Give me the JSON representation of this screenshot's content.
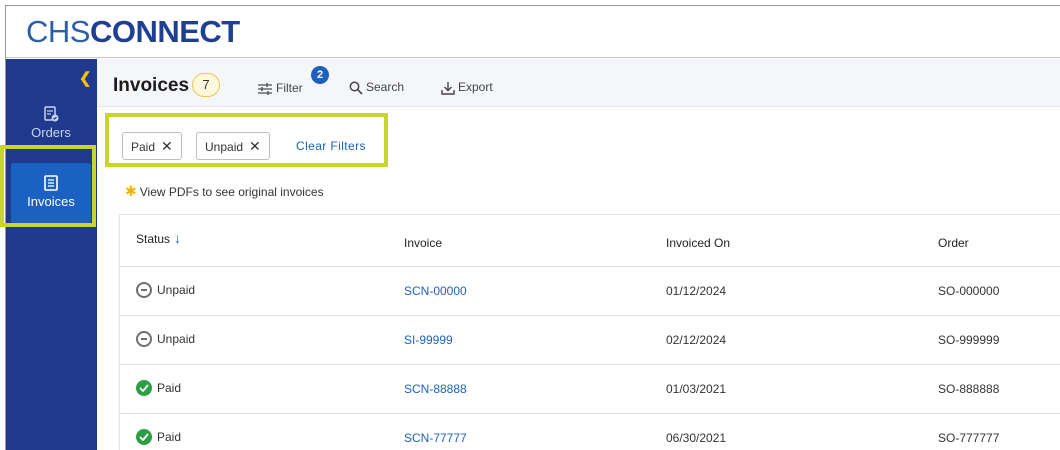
{
  "brand": {
    "part1": "CHS",
    "part2": "CONNECT"
  },
  "sidebar": {
    "collapse_icon": "chevron-left-icon",
    "items": [
      {
        "label": "Orders",
        "icon": "orders-document-icon",
        "active": false
      },
      {
        "label": "Invoices",
        "icon": "invoice-document-icon",
        "active": true
      }
    ]
  },
  "header": {
    "title": "Invoices",
    "count": "7",
    "filter_label": "Filter",
    "filter_badge": "2",
    "search_label": "Search",
    "export_label": "Export"
  },
  "filters": {
    "chips": [
      {
        "label": "Paid"
      },
      {
        "label": "Unpaid"
      }
    ],
    "clear_label": "Clear Filters"
  },
  "note": "View PDFs to see original invoices",
  "table": {
    "columns": [
      "Status",
      "Invoice",
      "Invoiced On",
      "Order"
    ],
    "rows": [
      {
        "status": "Unpaid",
        "invoice": "SCN-00000",
        "invoiced_on": "01/12/2024",
        "order": "SO-000000"
      },
      {
        "status": "Unpaid",
        "invoice": "SI-99999",
        "invoiced_on": "02/12/2024",
        "order": "SO-999999"
      },
      {
        "status": "Paid",
        "invoice": "SCN-88888",
        "invoiced_on": "01/03/2021",
        "order": "SO-888888"
      },
      {
        "status": "Paid",
        "invoice": "SCN-77777",
        "invoiced_on": "06/30/2021",
        "order": "SO-777777"
      }
    ]
  },
  "colors": {
    "sidebar": "#1f3a8c",
    "active_nav": "#1b61c2",
    "link": "#1c63b9",
    "highlight": "#c8d62b",
    "paid": "#2e9e46",
    "unpaid": "#6f6f6f"
  }
}
